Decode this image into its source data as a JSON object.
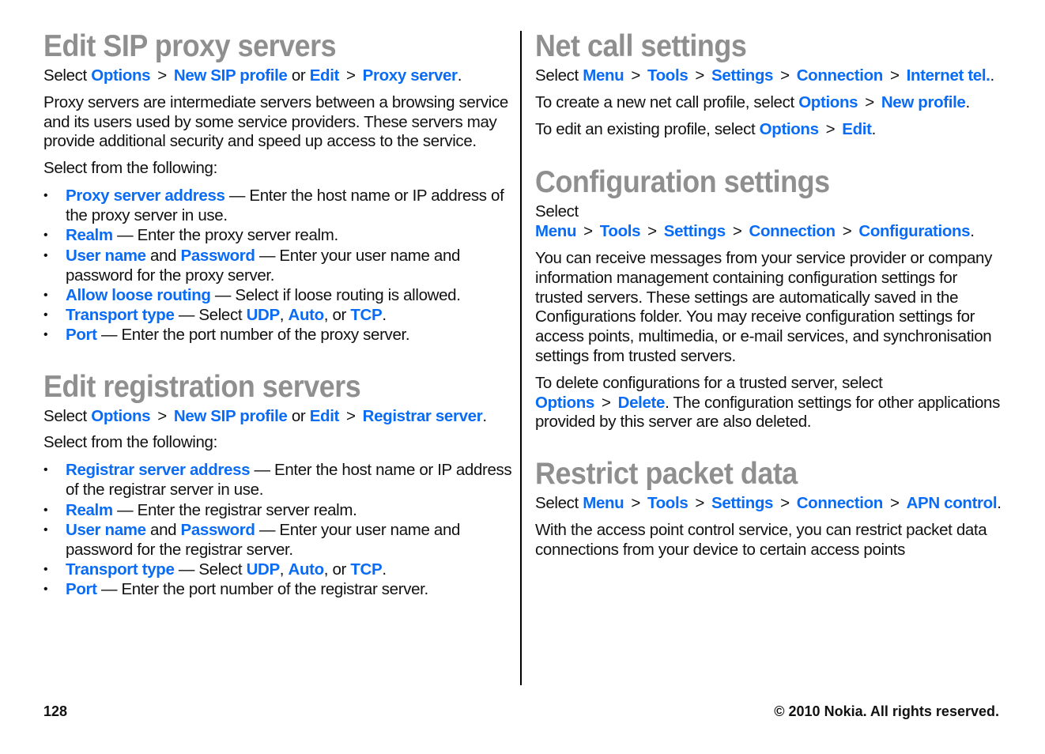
{
  "left": {
    "sip": {
      "title": "Edit SIP proxy servers",
      "path": {
        "pre": "Select ",
        "a": "Options",
        "b": "New SIP profile",
        "or": " or ",
        "c": "Edit",
        "d": "Proxy server",
        "end": "."
      },
      "intro": "Proxy servers are intermediate servers between a browsing service and its users used by some service providers. These servers may provide additional security and speed up access to the service.",
      "select_from": "Select from the following:",
      "items": [
        {
          "k": "Proxy server address",
          "t": " — Enter the host name or IP address of the proxy server in use."
        },
        {
          "k": "Realm",
          "t": " — Enter the proxy server realm."
        },
        {
          "k": "User name",
          "mid": " and ",
          "k2": "Password",
          "t": " — Enter your user name and password for the proxy server."
        },
        {
          "k": "Allow loose routing",
          "t": " — Select if loose routing is allowed."
        },
        {
          "k": "Transport type",
          "t": " — Select ",
          "o1": "UDP",
          "s1": ", ",
          "o2": "Auto",
          "s2": ", or ",
          "o3": "TCP",
          "e": "."
        },
        {
          "k": "Port",
          "t": " — Enter the port number of the proxy server."
        }
      ]
    },
    "reg": {
      "title": "Edit registration servers",
      "path": {
        "pre": "Select ",
        "a": "Options",
        "b": "New SIP profile",
        "or": " or ",
        "c": "Edit",
        "d": "Registrar server",
        "end": "."
      },
      "select_from": "Select from the following:",
      "items": [
        {
          "k": "Registrar server address",
          "t": " — Enter the host name or IP address of the registrar server in use."
        },
        {
          "k": "Realm",
          "t": " — Enter the registrar server realm."
        },
        {
          "k": "User name",
          "mid": " and ",
          "k2": "Password",
          "t": " — Enter your user name and password for the registrar server."
        },
        {
          "k": "Transport type",
          "t": " — Select ",
          "o1": "UDP",
          "s1": ", ",
          "o2": "Auto",
          "s2": ", or ",
          "o3": "TCP",
          "e": "."
        },
        {
          "k": "Port",
          "t": " — Enter the port number of the registrar server."
        }
      ]
    }
  },
  "right": {
    "net": {
      "title": "Net call settings",
      "path": {
        "pre": "Select ",
        "a": "Menu",
        "b": "Tools",
        "c": "Settings",
        "d": "Connection",
        "e": "Internet tel.",
        "end": "."
      },
      "create": {
        "pre": "To create a new net call profile, select ",
        "a": "Options",
        "b": "New profile",
        "end": "."
      },
      "edit": {
        "pre": "To edit an existing profile, select ",
        "a": "Options",
        "b": "Edit",
        "end": "."
      }
    },
    "config": {
      "title": "Configuration settings",
      "path": {
        "pre": "Select ",
        "a": "Menu",
        "b": "Tools",
        "c": "Settings",
        "d": "Connection",
        "e": "Configurations",
        "end": "."
      },
      "body": "You can receive messages from your service provider or company information management containing configuration settings for trusted servers. These settings are automatically saved in the Configurations folder. You may receive configuration settings for access points, multimedia, or e-mail services, and synchronisation settings from trusted servers.",
      "delete": {
        "pre": "To delete configurations for a trusted server, select ",
        "a": "Options",
        "b": "Delete",
        "post": ". The configuration settings for other applications provided by this server are also deleted."
      }
    },
    "restrict": {
      "title": "Restrict packet data",
      "path": {
        "pre": "Select ",
        "a": "Menu",
        "b": "Tools",
        "c": "Settings",
        "d": "Connection",
        "e": "APN control",
        "end": "."
      },
      "body": "With the access point control service, you can restrict packet data connections from your device to certain access points"
    }
  },
  "footer": {
    "page": "128",
    "copyright": "© 2010 Nokia. All rights reserved."
  },
  "colors": {
    "link": "#0a6cf5",
    "heading": "#8f8f8f",
    "text": "#111111"
  },
  "sep": ">"
}
